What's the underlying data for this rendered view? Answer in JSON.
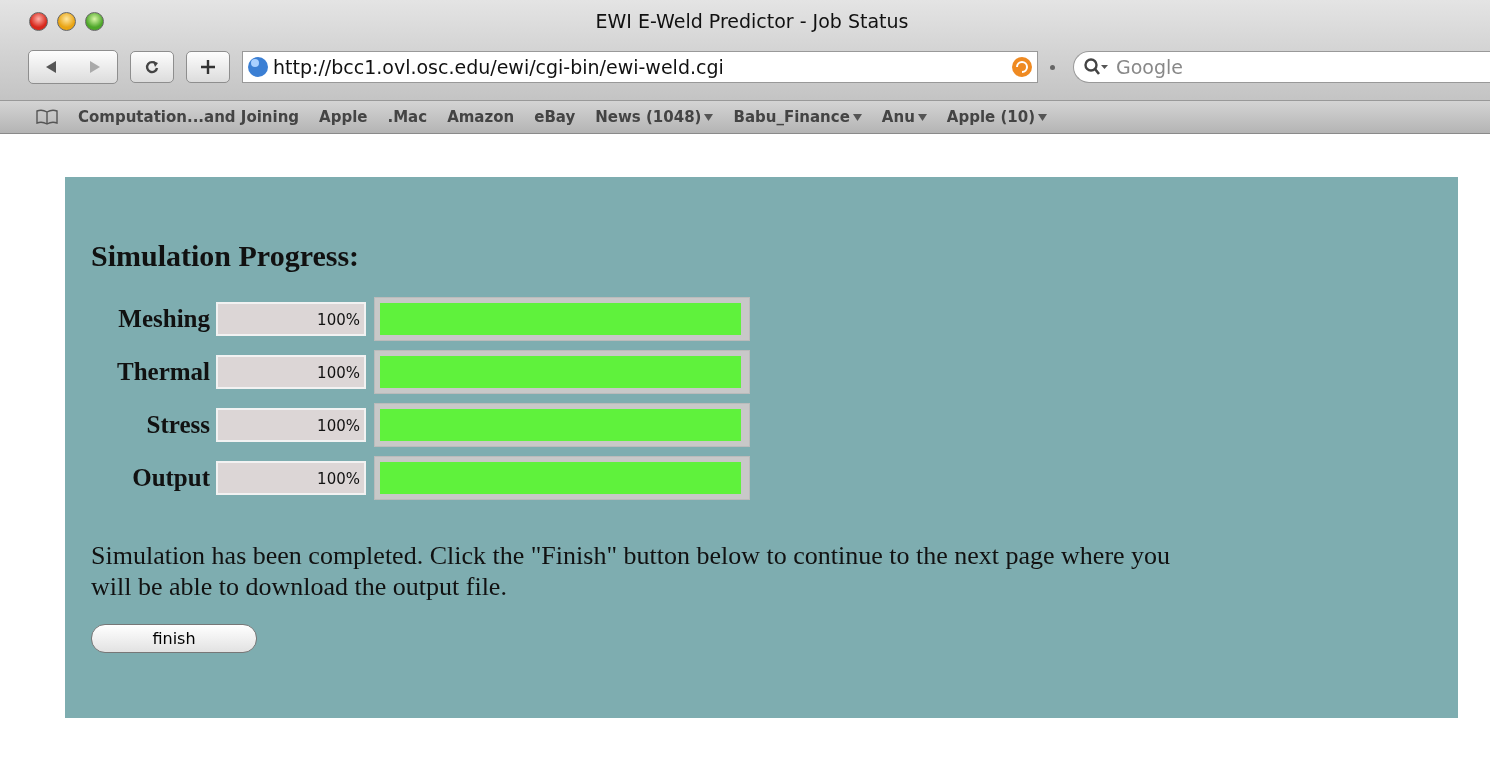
{
  "window": {
    "title": "EWI E-Weld Predictor - Job Status"
  },
  "toolbar": {
    "address": "http://bcc1.ovl.osc.edu/ewi/cgi-bin/ewi-weld.cgi",
    "search": {
      "placeholder": "Google"
    }
  },
  "bookmarks": [
    {
      "label": "Computation...and Joining",
      "menu": false
    },
    {
      "label": "Apple",
      "menu": false
    },
    {
      "label": ".Mac",
      "menu": false
    },
    {
      "label": "Amazon",
      "menu": false
    },
    {
      "label": "eBay",
      "menu": false
    },
    {
      "label": "News (1048)",
      "menu": true
    },
    {
      "label": "Babu_Finance",
      "menu": true
    },
    {
      "label": "Anu",
      "menu": true
    },
    {
      "label": "Apple (10)",
      "menu": true
    }
  ],
  "page": {
    "heading": "Simulation Progress:",
    "stages": [
      {
        "name": "Meshing",
        "reading": "100%",
        "level": 1
      },
      {
        "name": "Thermal",
        "reading": "100%",
        "level": 1
      },
      {
        "name": "Stress",
        "reading": "100%",
        "level": 1
      },
      {
        "name": "Output",
        "reading": "100%",
        "level": 1
      }
    ],
    "message": "Simulation has been completed. Click the \"Finish\" button below to continue to the next page where you will be able to download the output file.",
    "button": "finish"
  }
}
